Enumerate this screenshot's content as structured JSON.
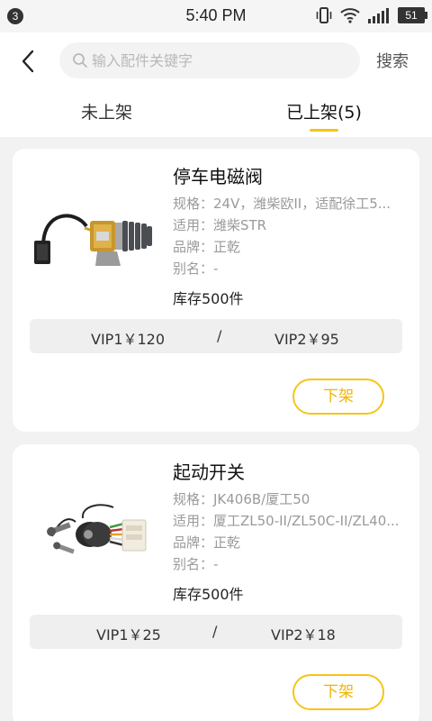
{
  "status_bar": {
    "notification_count": "3",
    "time": "5:40 PM",
    "battery": "51"
  },
  "header": {
    "search_placeholder": "输入配件关键字",
    "search_label": "搜索"
  },
  "tabs": [
    {
      "label": "未上架"
    },
    {
      "label": "已上架(5)"
    }
  ],
  "products": [
    {
      "title": "停车电磁阀",
      "spec": "规格：24V，潍柴欧II，适配徐工5...",
      "fit": "适用：潍柴STR",
      "brand": "品牌：正乾",
      "alias": "别名：-",
      "stock": "库存500件",
      "vip1_price": "VIP1￥120",
      "price_separator": "/",
      "vip2_price": "VIP2￥95",
      "delist_label": "下架"
    },
    {
      "title": "起动开关",
      "spec": "规格：JK406B/厦工50",
      "fit": "适用：厦工ZL50-II/ZL50C-II/ZL40...",
      "brand": "品牌：正乾",
      "alias": "别名：-",
      "stock": "库存500件",
      "vip1_price": "VIP1￥25",
      "price_separator": "/",
      "vip2_price": "VIP2￥18",
      "delist_label": "下架"
    }
  ],
  "colors": {
    "accent": "#f5c518",
    "background": "#f2f2f2",
    "card": "#ffffff",
    "muted_text": "#9a9a9a"
  },
  "icons": {
    "back": "chevron-left-icon",
    "search": "search-icon",
    "vibrate": "vibrate-icon",
    "wifi": "wifi-icon",
    "signal": "signal-icon",
    "battery": "battery-icon"
  }
}
